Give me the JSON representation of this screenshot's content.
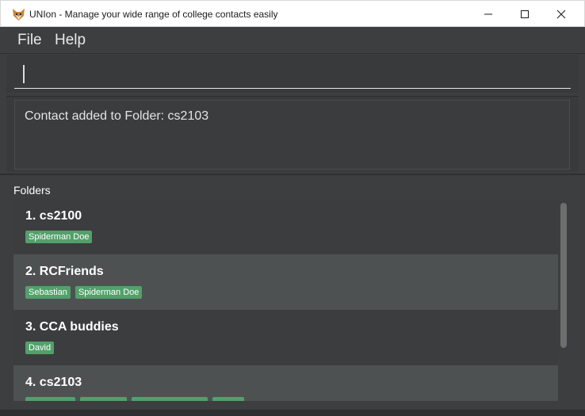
{
  "window": {
    "title": "UNIon - Manage your wide range of college contacts easily",
    "app_icon": "fox-icon"
  },
  "menu": {
    "file_label": "File",
    "help_label": "Help"
  },
  "command": {
    "value": "",
    "placeholder": ""
  },
  "result": {
    "message": "Contact added to Folder: cs2103"
  },
  "folders": {
    "heading": "Folders",
    "items": [
      {
        "name": "1.  cs2100",
        "tags": [
          "Spiderman Doe"
        ]
      },
      {
        "name": "2.  RCFriends",
        "tags": [
          "Sebastian",
          "Spiderman Doe"
        ]
      },
      {
        "name": "3.  CCA buddies",
        "tags": [
          "David"
        ]
      },
      {
        "name": "4.  cs2103",
        "tags": [
          "",
          "",
          "",
          ""
        ]
      }
    ]
  },
  "colors": {
    "tag": "#52a06a",
    "row_dark": "#3b3d3e",
    "row_light": "#4e5152",
    "background": "#3c3e3f"
  }
}
